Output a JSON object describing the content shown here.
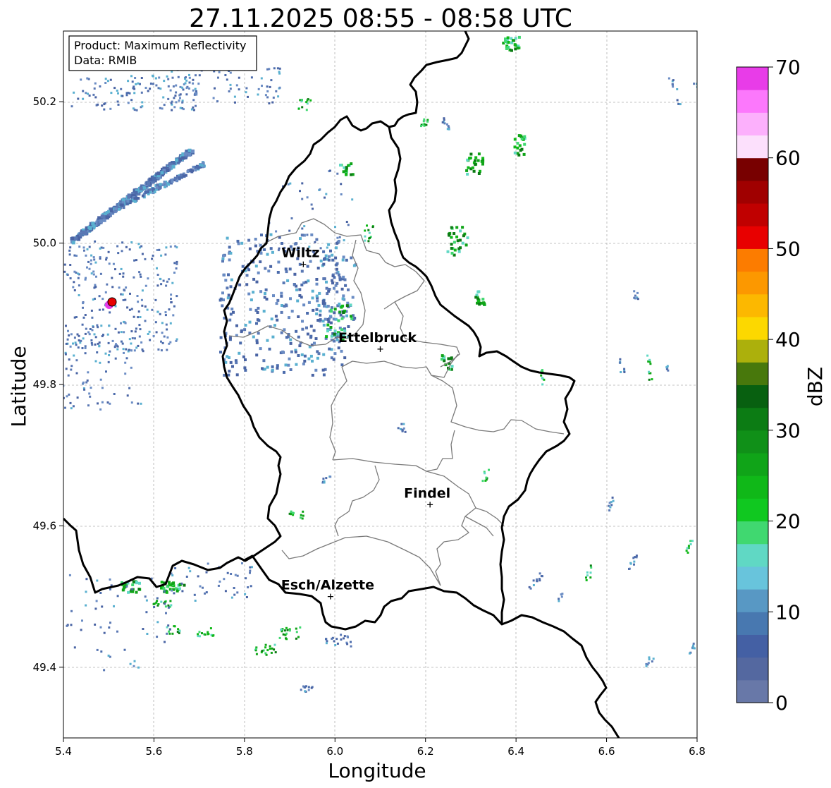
{
  "title": "27.11.2025 08:55 - 08:58 UTC",
  "xlabel": "Longitude",
  "ylabel": "Latitude",
  "x_ticks": [
    "5.4",
    "5.6",
    "5.8",
    "6.0",
    "6.2",
    "6.4",
    "6.6",
    "6.8"
  ],
  "y_ticks": [
    "49.4",
    "49.6",
    "49.8",
    "50.0",
    "50.2"
  ],
  "info_box": {
    "product": "Product: Maximum Reflectivity",
    "data": "Data: RMIB"
  },
  "colorbar": {
    "label": "dBZ",
    "ticks": [
      "0",
      "10",
      "20",
      "30",
      "40",
      "50",
      "60",
      "70"
    ],
    "colors": [
      "#6878a8",
      "#5468a0",
      "#4460a4",
      "#4878b0",
      "#5898c4",
      "#68c4dc",
      "#60d8c4",
      "#40d870",
      "#10c820",
      "#10b818",
      "#10a418",
      "#109018",
      "#0c7c14",
      "#086010",
      "#48780c",
      "#acb00c",
      "#fcd800",
      "#fcb800",
      "#fc9800",
      "#fc7c00",
      "#e80000",
      "#c00000",
      "#a00000",
      "#780000",
      "#fce0fc",
      "#fcb0fc",
      "#fc78fc",
      "#e83ce8"
    ]
  },
  "cities": [
    {
      "name": "Wiltz",
      "lon": 5.93,
      "lat": 49.97
    },
    {
      "name": "Ettelbruck",
      "lon": 6.1,
      "lat": 49.85
    },
    {
      "name": "Findel",
      "lon": 6.21,
      "lat": 49.63
    },
    {
      "name": "Esch/Alzette",
      "lon": 5.99,
      "lat": 49.5
    }
  ],
  "map_extent": {
    "lon": [
      5.4,
      6.8
    ],
    "lat": [
      49.3,
      50.3
    ]
  }
}
